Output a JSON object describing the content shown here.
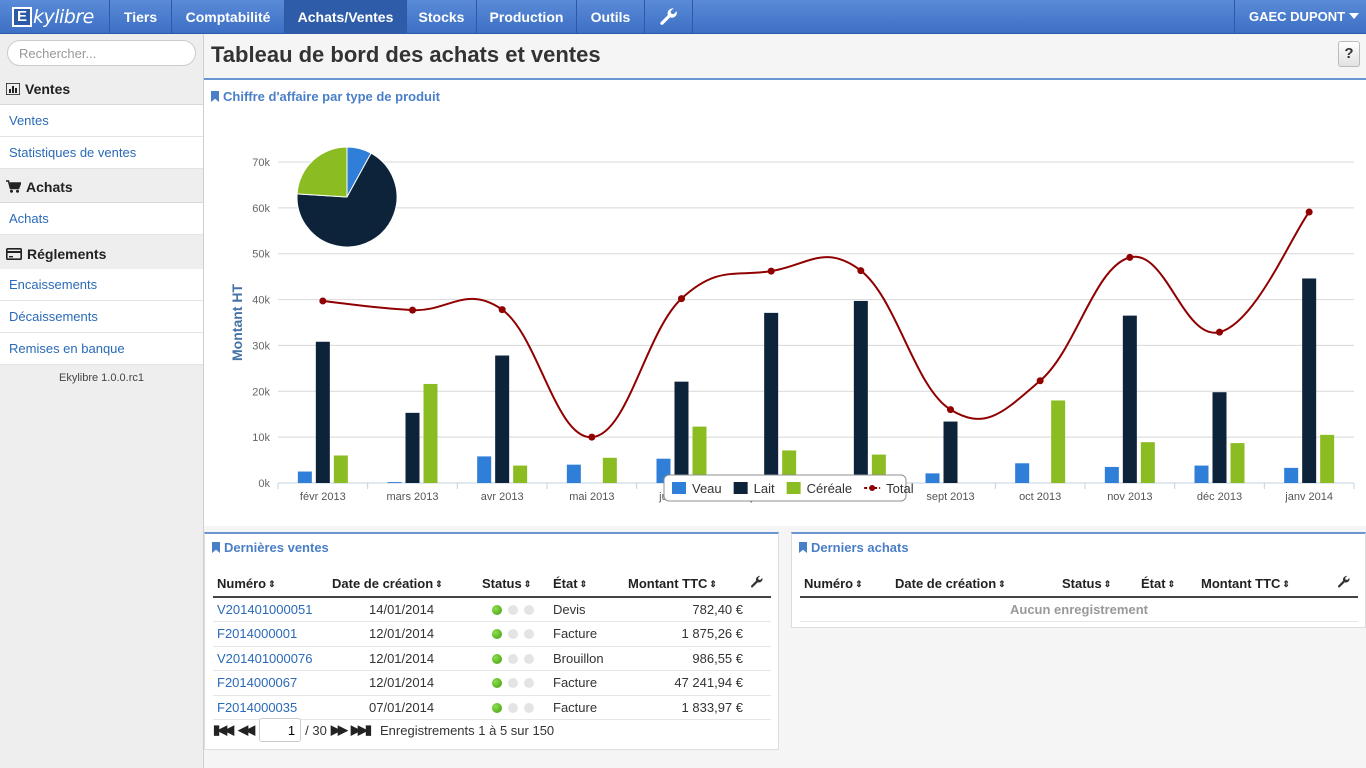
{
  "app": {
    "logo_letter": "E",
    "logo_text": "kylibre"
  },
  "nav": {
    "items": [
      "Tiers",
      "Comptabilité",
      "Achats/Ventes",
      "Stocks",
      "Production",
      "Outils"
    ],
    "active": "Achats/Ventes",
    "user": "GAEC DUPONT",
    "tools_icon": "wrench-icon"
  },
  "sidebar": {
    "search_placeholder": "Rechercher...",
    "sections": [
      {
        "title": "Ventes",
        "icon": "bar-chart-icon",
        "links": [
          "Ventes",
          "Statistiques de ventes"
        ]
      },
      {
        "title": "Achats",
        "icon": "cart-icon",
        "links": [
          "Achats"
        ]
      },
      {
        "title": "Réglements",
        "icon": "credit-card-icon",
        "links": [
          "Encaissements",
          "Décaissements",
          "Remises en banque"
        ]
      }
    ],
    "version": "Ekylibre 1.0.0.rc1"
  },
  "page": {
    "title": "Tableau de bord des achats et ventes",
    "help": "?"
  },
  "chart_panel": {
    "title": "Chiffre d'affaire par type de produit"
  },
  "chart_data": {
    "type": "bar",
    "title": "",
    "ylabel": "Montant HT",
    "ylim": [
      0,
      70000
    ],
    "yticks": [
      "0k",
      "10k",
      "20k",
      "30k",
      "40k",
      "50k",
      "60k",
      "70k"
    ],
    "categories": [
      "févr 2013",
      "mars 2013",
      "avr 2013",
      "mai 2013",
      "juin 2013",
      "juil 2013",
      "août 2013",
      "sept 2013",
      "oct 2013",
      "nov 2013",
      "déc 2013",
      "janv 2014"
    ],
    "series": [
      {
        "name": "Veau",
        "color": "#2f7ed8",
        "type": "bar",
        "values": [
          2500,
          200,
          5800,
          4000,
          5300,
          1500,
          0,
          2100,
          4300,
          3500,
          3800,
          3300
        ]
      },
      {
        "name": "Lait",
        "color": "#0d233a",
        "type": "bar",
        "values": [
          30800,
          15300,
          27800,
          0,
          22100,
          37100,
          39700,
          13400,
          0,
          36500,
          19800,
          44600
        ]
      },
      {
        "name": "Céréale",
        "color": "#8bbc21",
        "type": "bar",
        "values": [
          6000,
          21600,
          3800,
          5500,
          12300,
          7100,
          6200,
          0,
          18000,
          8900,
          8700,
          10500
        ]
      },
      {
        "name": "Total",
        "color": "#910000",
        "type": "line",
        "values": [
          39700,
          37700,
          37800,
          10000,
          40200,
          46200,
          46300,
          16000,
          22300,
          49200,
          32900,
          59100
        ]
      }
    ],
    "pie": {
      "labels": [
        "Veau",
        "Lait",
        "Céréale"
      ],
      "values": [
        8,
        68,
        24
      ]
    },
    "legend": "bottom-center",
    "grid": true
  },
  "recent_sales": {
    "title": "Dernières ventes",
    "columns": [
      "Numéro",
      "Date de création",
      "Status",
      "État",
      "Montant TTC"
    ],
    "rows": [
      {
        "number": "V201401000051",
        "date": "14/01/2014",
        "status": "green",
        "state": "Devis",
        "amount": "782,40 €"
      },
      {
        "number": "F2014000001",
        "date": "12/01/2014",
        "status": "green",
        "state": "Facture",
        "amount": "1 875,26 €"
      },
      {
        "number": "V201401000076",
        "date": "12/01/2014",
        "status": "green",
        "state": "Brouillon",
        "amount": "986,55 €"
      },
      {
        "number": "F2014000067",
        "date": "12/01/2014",
        "status": "green",
        "state": "Facture",
        "amount": "47 241,94 €"
      },
      {
        "number": "F2014000035",
        "date": "07/01/2014",
        "status": "green",
        "state": "Facture",
        "amount": "1 833,97 €"
      }
    ],
    "pager": {
      "current_page": "1",
      "total_pages": "/ 30",
      "summary": "Enregistrements 1 à 5 sur 150"
    }
  },
  "recent_purchases": {
    "title": "Derniers achats",
    "columns": [
      "Numéro",
      "Date de création",
      "Status",
      "État",
      "Montant TTC"
    ],
    "empty": "Aucun enregistrement"
  }
}
